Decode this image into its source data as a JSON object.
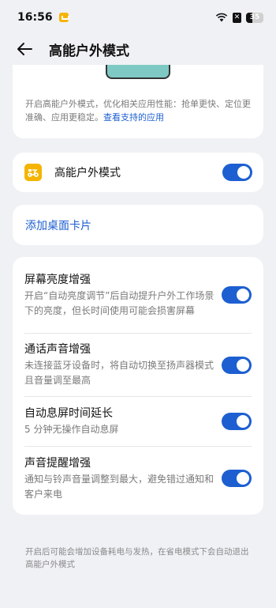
{
  "status_bar": {
    "time": "16:56",
    "battery": "35"
  },
  "header": {
    "title": "高能户外模式"
  },
  "intro": {
    "text": "开启高能户外模式，优化相关应用性能：抢单更快、定位更准确、应用更稳定。",
    "link": "查看支持的应用"
  },
  "main_toggle": {
    "label": "高能户外模式",
    "enabled": true
  },
  "widget": {
    "label": "添加桌面卡片"
  },
  "settings": [
    {
      "title": "屏幕亮度增强",
      "desc": "开启“自动亮度调节”后自动提升户外工作场景下的亮度，但长时间使用可能会损害屏幕",
      "enabled": true
    },
    {
      "title": "通话声音增强",
      "desc": "未连接蓝牙设备时，将自动切换至扬声器模式且音量调至最高",
      "enabled": true
    },
    {
      "title": "自动息屏时间延长",
      "desc": "5 分钟无操作自动息屏",
      "enabled": true
    },
    {
      "title": "声音提醒增强",
      "desc": "通知与铃声音量调整到最大，避免错过通知和客户来电",
      "enabled": true
    }
  ],
  "footer": {
    "text": "开启后可能会增加设备耗电与发热，在省电模式下会自动退出高能户外模式"
  },
  "colors": {
    "accent": "#1d5fd1",
    "icon_yellow": "#f4b400",
    "background": "#f0f1f5"
  }
}
